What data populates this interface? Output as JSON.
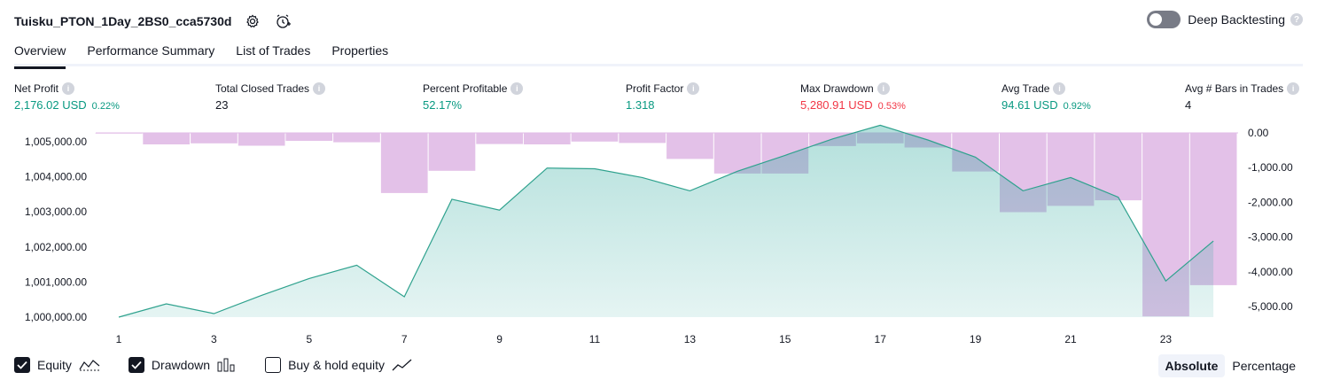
{
  "header": {
    "strategy_title": "Tuisku_PTON_1Day_2BS0_cca5730d",
    "deep_backtesting_label": "Deep Backtesting"
  },
  "tabs": [
    {
      "label": "Overview",
      "active": true
    },
    {
      "label": "Performance Summary",
      "active": false
    },
    {
      "label": "List of Trades",
      "active": false
    },
    {
      "label": "Properties",
      "active": false
    }
  ],
  "metrics": [
    {
      "label": "Net Profit",
      "value": "2,176.02 USD",
      "pct": "0.22%",
      "tone": "pos"
    },
    {
      "label": "Total Closed Trades",
      "value": "23",
      "pct": "",
      "tone": "neutral"
    },
    {
      "label": "Percent Profitable",
      "value": "52.17%",
      "pct": "",
      "tone": "pos"
    },
    {
      "label": "Profit Factor",
      "value": "1.318",
      "pct": "",
      "tone": "pos"
    },
    {
      "label": "Max Drawdown",
      "value": "5,280.91 USD",
      "pct": "0.53%",
      "tone": "neg"
    },
    {
      "label": "Avg Trade",
      "value": "94.61 USD",
      "pct": "0.92%",
      "tone": "pos"
    },
    {
      "label": "Avg # Bars in Trades",
      "value": "4",
      "pct": "",
      "tone": "neutral"
    }
  ],
  "chart_data": {
    "type": "line",
    "x_ticks": [
      "1",
      "3",
      "5",
      "7",
      "9",
      "11",
      "13",
      "15",
      "17",
      "19",
      "21",
      "23"
    ],
    "x_range": [
      1,
      24
    ],
    "equity": {
      "ylim": [
        1000000,
        1005000
      ],
      "y_ticks": [
        "1,000,000.00",
        "1,001,000.00",
        "1,002,000.00",
        "1,003,000.00",
        "1,004,000.00",
        "1,005,000.00"
      ],
      "x": [
        1,
        2,
        3,
        4,
        5,
        6,
        7,
        8,
        9,
        10,
        11,
        12,
        13,
        14,
        15,
        16,
        17,
        18,
        19,
        20,
        21,
        22,
        23,
        24
      ],
      "values": [
        1000000,
        1000380,
        1000100,
        1000620,
        1001100,
        1001480,
        1000580,
        1003360,
        1003050,
        1004250,
        1004230,
        1003980,
        1003600,
        1004160,
        1004610,
        1005080,
        1005470,
        1005050,
        1004560,
        1003600,
        1003980,
        1003420,
        1001030,
        1002170
      ],
      "line_color": "#2fa28e",
      "fill_color": "#26a69a"
    },
    "drawdown": {
      "ylim": [
        -5300,
        0
      ],
      "y_ticks": [
        "0.00",
        "-1,000.00",
        "-2,000.00",
        "-3,000.00",
        "-4,000.00",
        "-5,000.00"
      ],
      "x": [
        1,
        2,
        3,
        4,
        5,
        6,
        7,
        8,
        9,
        10,
        11,
        12,
        13,
        14,
        15,
        16,
        17,
        18,
        19,
        20,
        21,
        22,
        23,
        24
      ],
      "values": [
        -20,
        -330,
        -300,
        -370,
        -230,
        -270,
        -1730,
        -1090,
        -320,
        -330,
        -250,
        -290,
        -750,
        -1170,
        -1170,
        -380,
        -300,
        -420,
        -1110,
        -2280,
        -2100,
        -1940,
        -5280,
        -4380
      ],
      "bar_color": "#e1bee7"
    },
    "grid": false
  },
  "legend": {
    "equity_label": "Equity",
    "drawdown_label": "Drawdown",
    "buyhold_label": "Buy & hold equity",
    "equity_checked": true,
    "drawdown_checked": true,
    "buyhold_checked": false
  },
  "modes": {
    "absolute_label": "Absolute",
    "percentage_label": "Percentage",
    "selected": "Absolute"
  }
}
